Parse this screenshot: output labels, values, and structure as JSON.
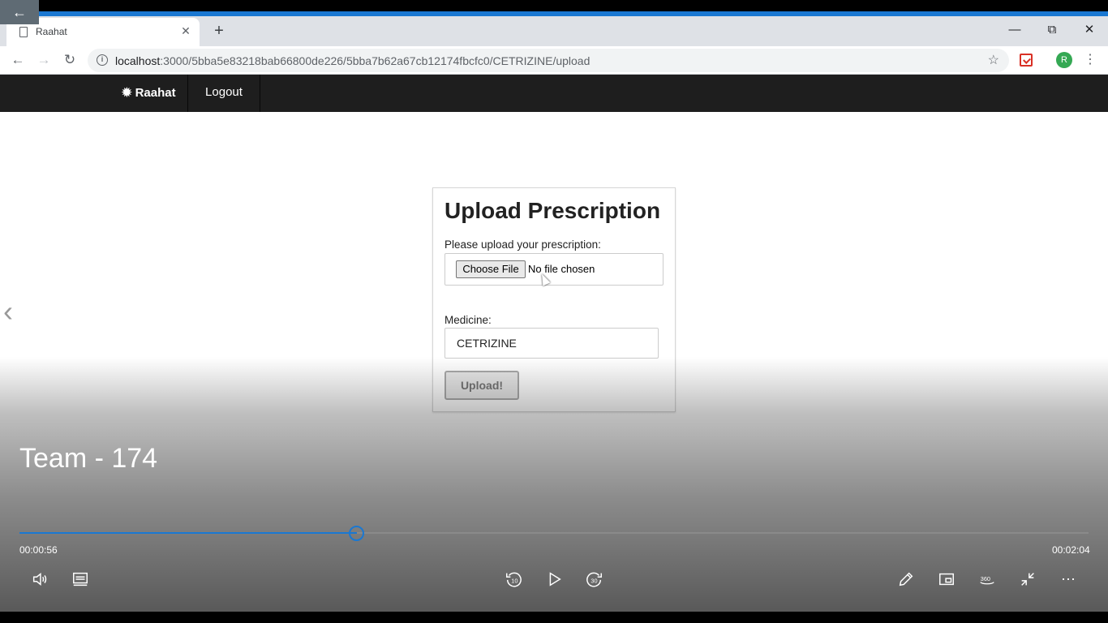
{
  "browser": {
    "tab_title": "Raahat",
    "url_host": "localhost",
    "url_path": ":3000/5bba5e83218bab66800de226/5bba7b62a67cb12174fbcfc0/CETRIZINE/upload",
    "profile_initial": "R"
  },
  "site": {
    "brand": "Raahat",
    "logout": "Logout"
  },
  "form": {
    "title": "Upload Prescription",
    "file_label": "Please upload your prescription:",
    "file_button": "Choose File",
    "file_status": "No file chosen",
    "medicine_label": "Medicine:",
    "medicine_value": "CETRIZINE",
    "submit_label": "Upload!"
  },
  "player": {
    "title": "Team - 174",
    "elapsed": "00:00:56",
    "duration": "00:02:04",
    "progress_fraction": 0.316,
    "accent_color": "#1a78d2",
    "skip_back": "10",
    "skip_forward": "30"
  }
}
